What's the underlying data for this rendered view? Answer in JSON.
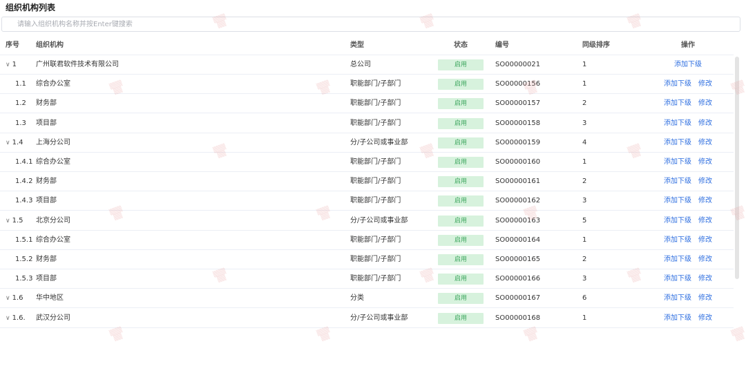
{
  "page_title": "组织机构列表",
  "search": {
    "placeholder": "请输入组织机构名称并按Enter键搜索"
  },
  "columns": {
    "seq": "序号",
    "name": "组织机构",
    "type": "类型",
    "status": "状态",
    "code": "编号",
    "sort": "同级排序",
    "ops": "操作"
  },
  "actions": {
    "add_child": "添加下级",
    "edit": "修改"
  },
  "colors": {
    "link": "#2f6fe0",
    "status_bg": "#d7f2dd",
    "status_fg": "#3ba55c"
  },
  "rows": [
    {
      "seq": "1",
      "expanded": true,
      "name": "广州联君软件技术有限公司",
      "type": "总公司",
      "status": "启用",
      "code": "SO00000021",
      "sort": "1",
      "editable": false
    },
    {
      "seq": "1.1",
      "expanded": false,
      "name": "综合办公室",
      "type": "职能部门/子部门",
      "status": "启用",
      "code": "SO00000156",
      "sort": "1",
      "editable": true
    },
    {
      "seq": "1.2",
      "expanded": false,
      "name": "财务部",
      "type": "职能部门/子部门",
      "status": "启用",
      "code": "SO00000157",
      "sort": "2",
      "editable": true
    },
    {
      "seq": "1.3",
      "expanded": false,
      "name": "项目部",
      "type": "职能部门/子部门",
      "status": "启用",
      "code": "SO00000158",
      "sort": "3",
      "editable": true
    },
    {
      "seq": "1.4",
      "expanded": true,
      "name": "上海分公司",
      "type": "分/子公司或事业部",
      "status": "启用",
      "code": "SO00000159",
      "sort": "4",
      "editable": true
    },
    {
      "seq": "1.4.1",
      "expanded": false,
      "name": "综合办公室",
      "type": "职能部门/子部门",
      "status": "启用",
      "code": "SO00000160",
      "sort": "1",
      "editable": true
    },
    {
      "seq": "1.4.2",
      "expanded": false,
      "name": "财务部",
      "type": "职能部门/子部门",
      "status": "启用",
      "code": "SO00000161",
      "sort": "2",
      "editable": true
    },
    {
      "seq": "1.4.3",
      "expanded": false,
      "name": "项目部",
      "type": "职能部门/子部门",
      "status": "启用",
      "code": "SO00000162",
      "sort": "3",
      "editable": true
    },
    {
      "seq": "1.5",
      "expanded": true,
      "name": "北京分公司",
      "type": "分/子公司或事业部",
      "status": "启用",
      "code": "SO00000163",
      "sort": "5",
      "editable": true
    },
    {
      "seq": "1.5.1",
      "expanded": false,
      "name": "综合办公室",
      "type": "职能部门/子部门",
      "status": "启用",
      "code": "SO00000164",
      "sort": "1",
      "editable": true
    },
    {
      "seq": "1.5.2",
      "expanded": false,
      "name": "财务部",
      "type": "职能部门/子部门",
      "status": "启用",
      "code": "SO00000165",
      "sort": "2",
      "editable": true
    },
    {
      "seq": "1.5.3",
      "expanded": false,
      "name": "项目部",
      "type": "职能部门/子部门",
      "status": "启用",
      "code": "SO00000166",
      "sort": "3",
      "editable": true
    },
    {
      "seq": "1.6",
      "expanded": true,
      "name": "华中地区",
      "type": "分类",
      "status": "启用",
      "code": "SO00000167",
      "sort": "6",
      "editable": true
    },
    {
      "seq": "1.6.",
      "expanded": true,
      "name": "武汉分公司",
      "type": "分/子公司或事业部",
      "status": "启用",
      "code": "SO00000168",
      "sort": "1",
      "editable": true
    }
  ]
}
